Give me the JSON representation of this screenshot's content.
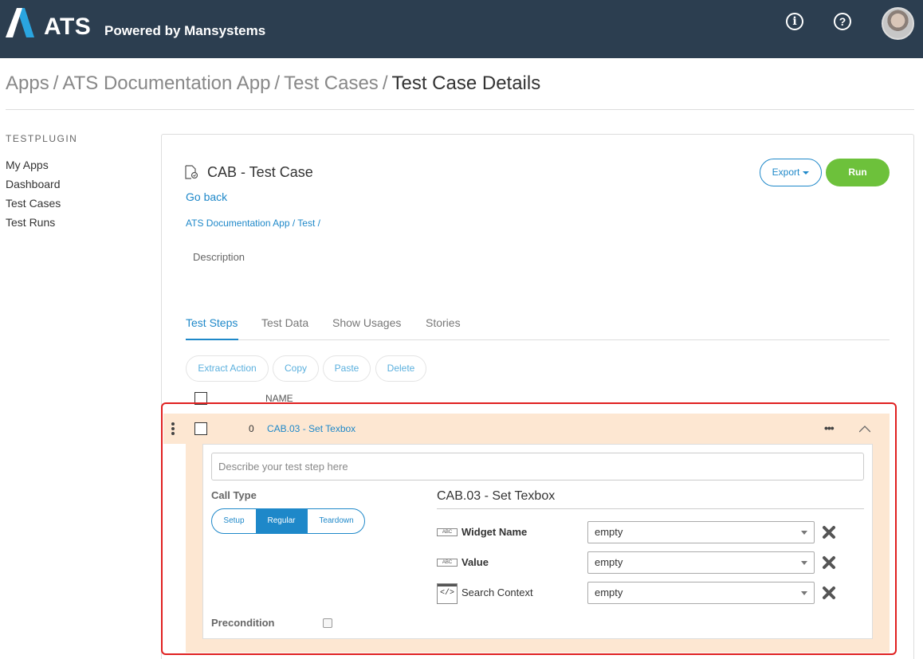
{
  "app": {
    "logo_text": "ATS",
    "logo_subtitle": "Powered by Mansystems",
    "info_icon": "info-icon",
    "help_icon": "help-icon"
  },
  "breadcrumb": {
    "items": [
      "Apps",
      "ATS Documentation App",
      "Test Cases"
    ],
    "separator": "/",
    "current": "Test Case Details"
  },
  "sidebar": {
    "heading": "TESTPLUGIN",
    "items": [
      "My Apps",
      "Dashboard",
      "Test Cases",
      "Test Runs"
    ]
  },
  "test_case": {
    "title": "CAB - Test Case",
    "go_back": "Go back",
    "path": "ATS Documentation App  / Test /",
    "description_label": "Description",
    "export_label": "Export",
    "run_label": "Run"
  },
  "tabs": [
    "Test Steps",
    "Test Data",
    "Show Usages",
    "Stories"
  ],
  "active_tab": "Test Steps",
  "actions": [
    "Extract Action",
    "Copy",
    "Paste",
    "Delete"
  ],
  "columns": {
    "name": "NAME"
  },
  "step": {
    "number": "0",
    "name": "CAB.03 - Set Texbox",
    "more": "•••",
    "description_placeholder": "Describe your test step here",
    "call_type_label": "Call Type",
    "call_types": [
      "Setup",
      "Regular",
      "Teardown"
    ],
    "selected_call_type": "Regular",
    "precondition_label": "Precondition",
    "precondition_checked": false,
    "action_title": "CAB.03 - Set Texbox",
    "params": [
      {
        "icon": "ABC",
        "label": "Widget Name",
        "value": "empty"
      },
      {
        "icon": "ABC",
        "label": "Value",
        "value": "empty"
      },
      {
        "icon": "</>",
        "label": "Search Context",
        "value": "empty"
      }
    ]
  },
  "colors": {
    "topbar": "#2c3e50",
    "accent": "#1e88c9",
    "run": "#6dc13b",
    "step_bg": "#fde7d2",
    "highlight": "#e02020"
  }
}
